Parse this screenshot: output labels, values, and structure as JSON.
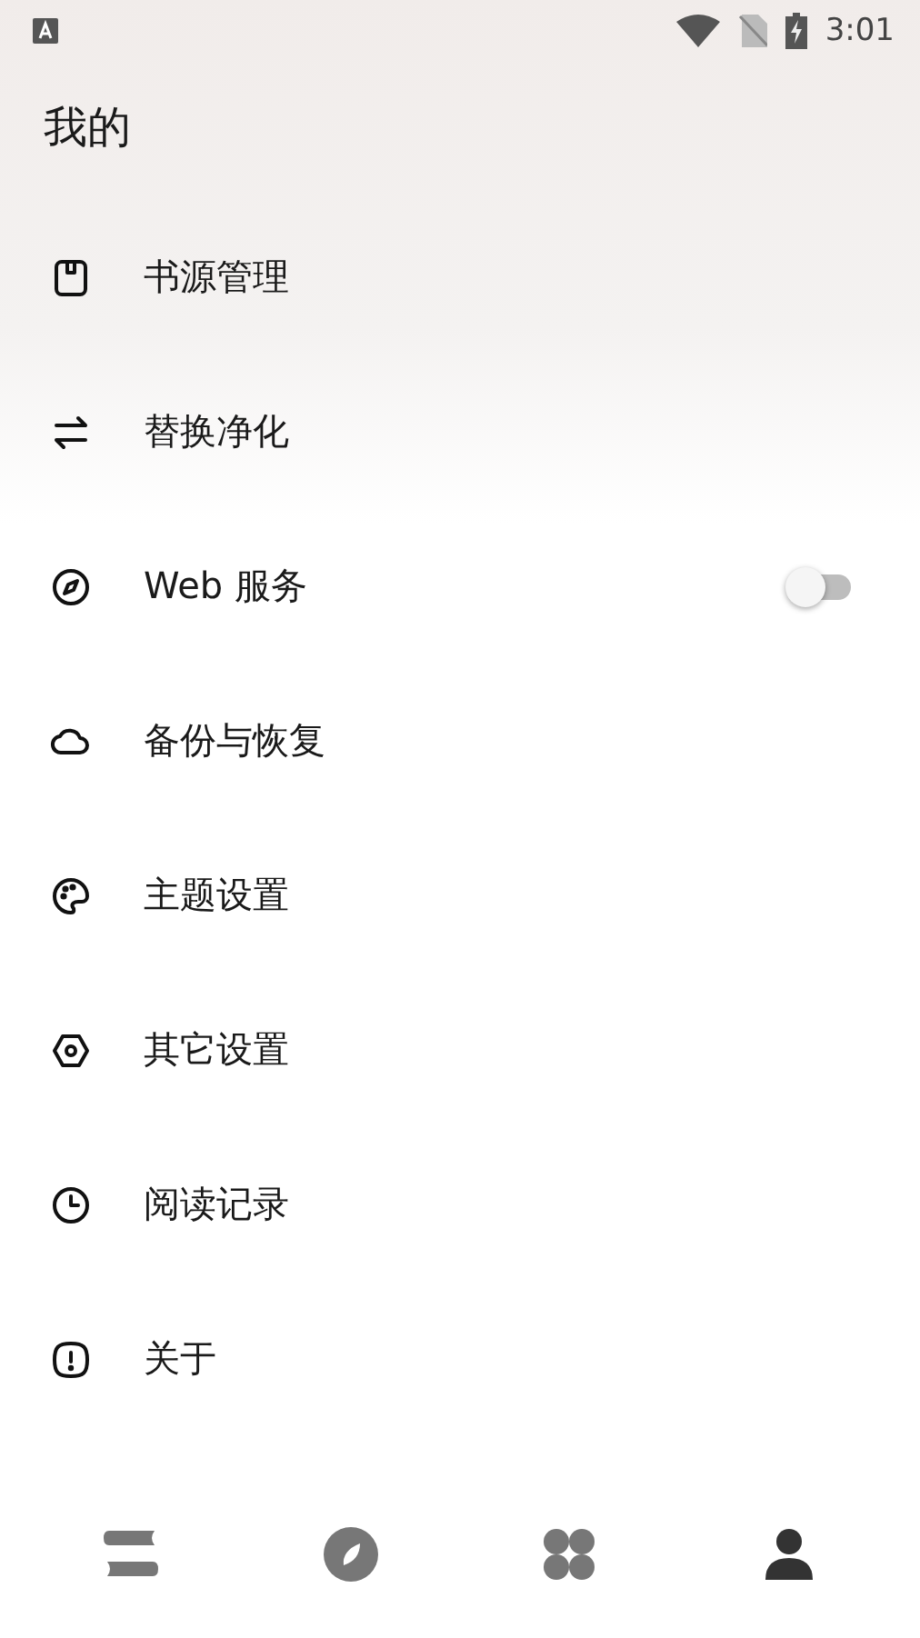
{
  "status_bar": {
    "time": "3:01"
  },
  "title": "我的",
  "items": [
    {
      "label": "书源管理",
      "kind": "link"
    },
    {
      "label": "替换净化",
      "kind": "link"
    },
    {
      "label": "Web 服务",
      "kind": "switch",
      "on": false
    },
    {
      "label": "备份与恢复",
      "kind": "link"
    },
    {
      "label": "主题设置",
      "kind": "link"
    },
    {
      "label": "其它设置",
      "kind": "link"
    },
    {
      "label": "阅读记录",
      "kind": "link"
    },
    {
      "label": "关于",
      "kind": "link"
    }
  ],
  "bottom_nav": [
    {
      "selected": false
    },
    {
      "selected": false
    },
    {
      "selected": false
    },
    {
      "selected": true
    }
  ]
}
